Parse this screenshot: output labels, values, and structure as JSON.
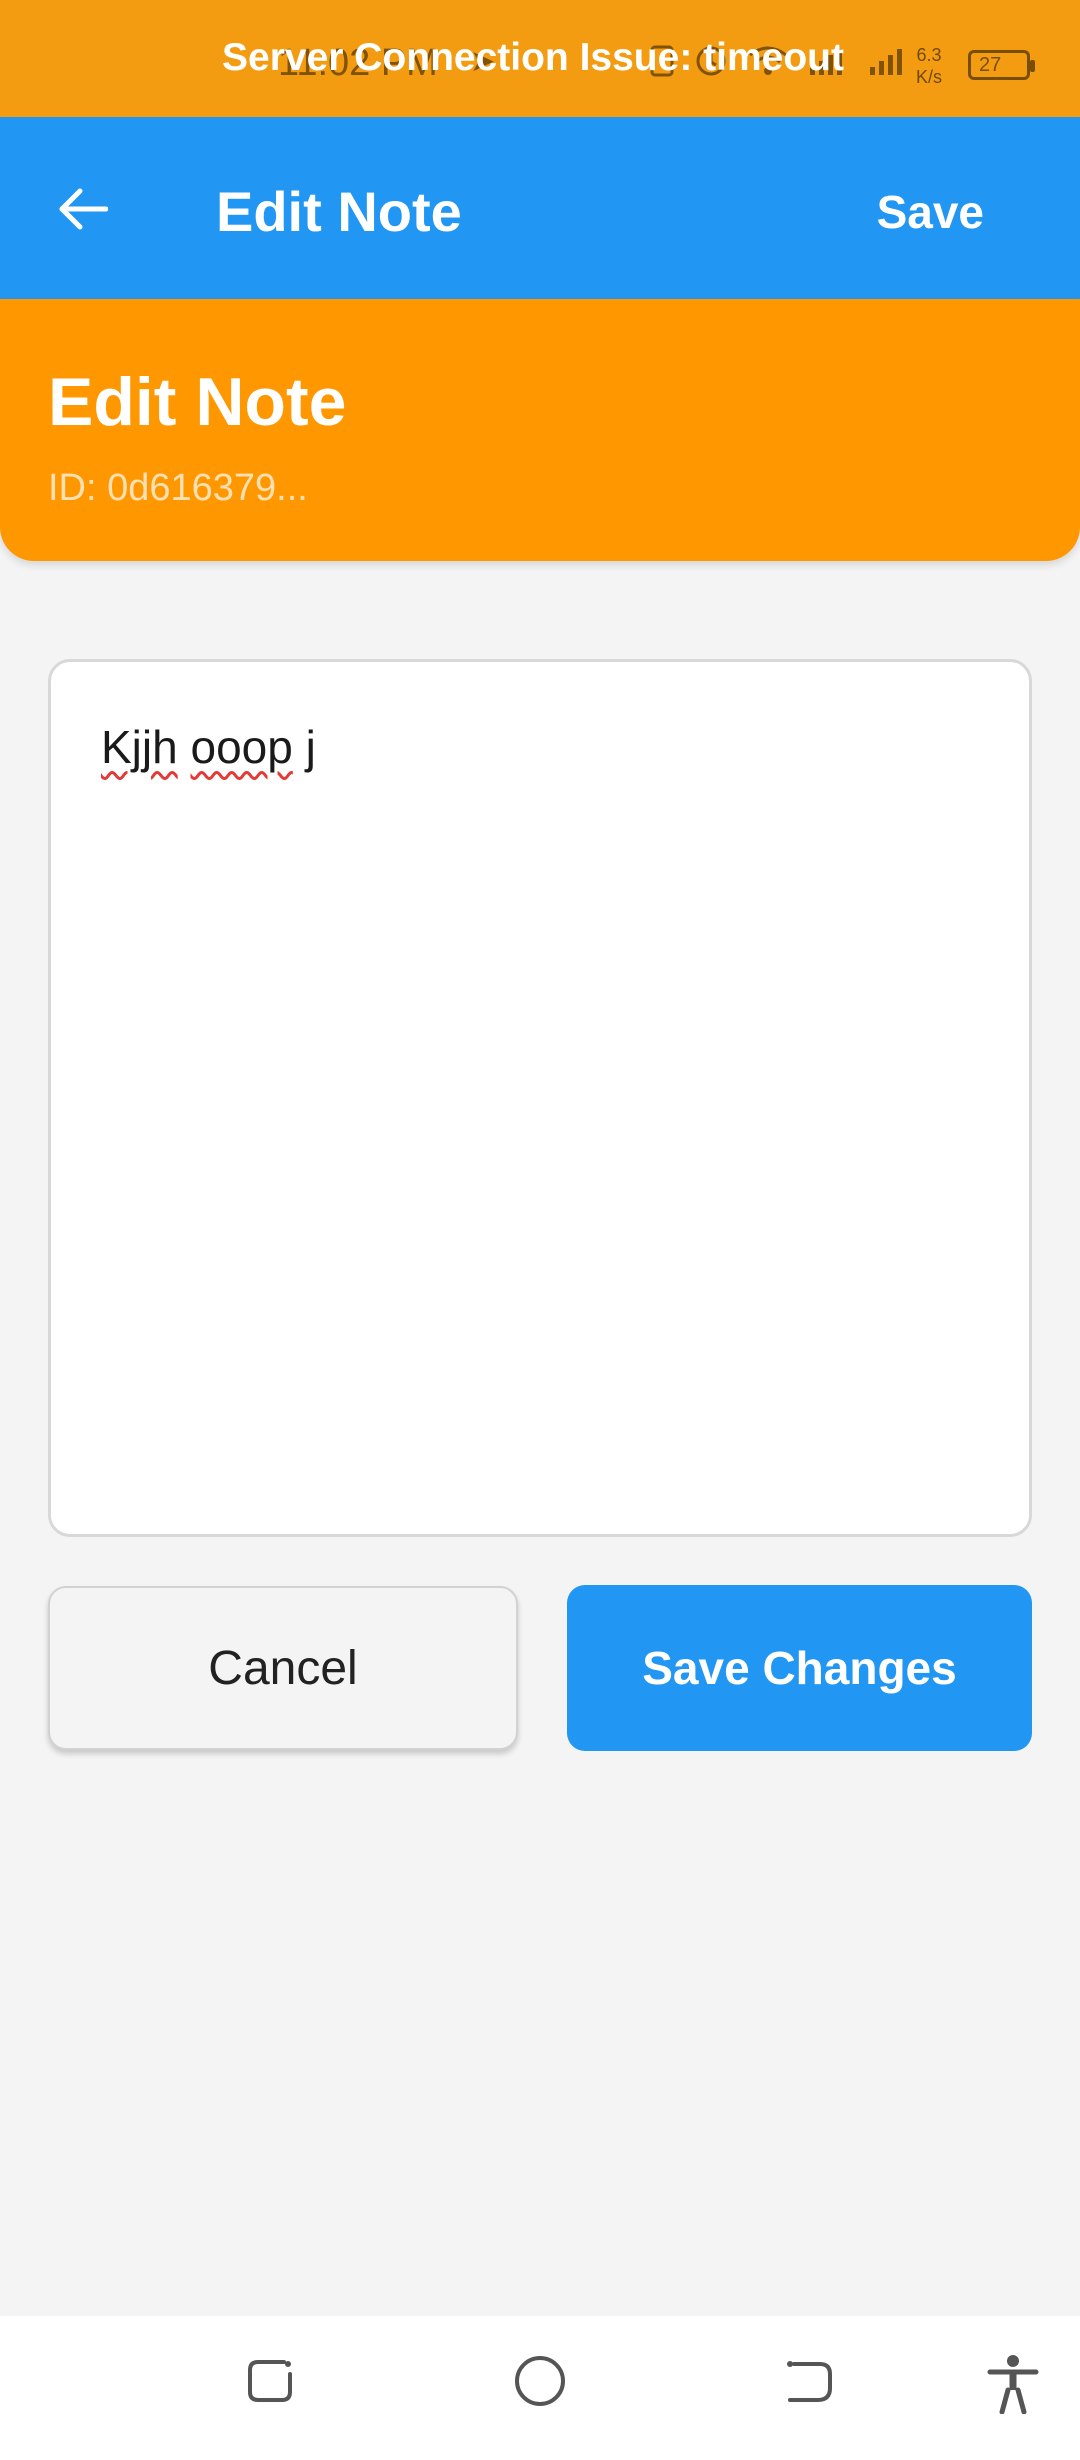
{
  "status_bar": {
    "time": "11:02 PM",
    "net_speed_value": "6.3",
    "net_speed_unit": "K/s",
    "battery": "27"
  },
  "banner": {
    "text": "Server Connection Issue: timeout"
  },
  "app_bar": {
    "title": "Edit Note",
    "save_label": "Save"
  },
  "header": {
    "title": "Edit Note",
    "id_text": "ID: 0d616379..."
  },
  "note": {
    "words": [
      "Kjjh",
      "ooop",
      "j"
    ]
  },
  "actions": {
    "cancel_label": "Cancel",
    "save_changes_label": "Save Changes"
  },
  "colors": {
    "primary": "#2196f3",
    "accent": "#ff9800",
    "status_bar": "#f39c12"
  },
  "icons": {
    "back": "arrow-left-icon",
    "nav_recents": "recents-icon",
    "nav_home": "home-circle-icon",
    "nav_back": "back-icon",
    "nav_accessibility": "accessibility-icon"
  }
}
